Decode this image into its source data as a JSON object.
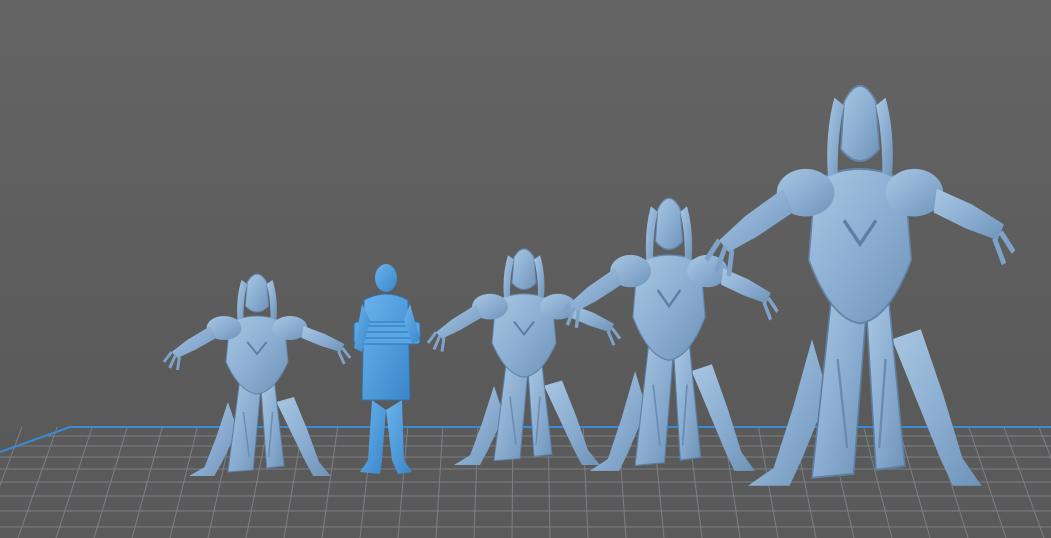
{
  "viewport": {
    "background": "#5f5f5f",
    "plate_grid_color": "#7b7f86",
    "plate_edge_color": "#3a8ad6"
  },
  "models": [
    {
      "name": "alien-warrior-small",
      "color": "#8fb3d6"
    },
    {
      "name": "human-scale-reference",
      "color": "#4d9bdb",
      "selected": true
    },
    {
      "name": "alien-warrior-medium",
      "color": "#8fb3d6"
    },
    {
      "name": "alien-warrior-large",
      "color": "#8fb3d6"
    },
    {
      "name": "alien-warrior-xlarge",
      "color": "#8fb3d6"
    }
  ]
}
